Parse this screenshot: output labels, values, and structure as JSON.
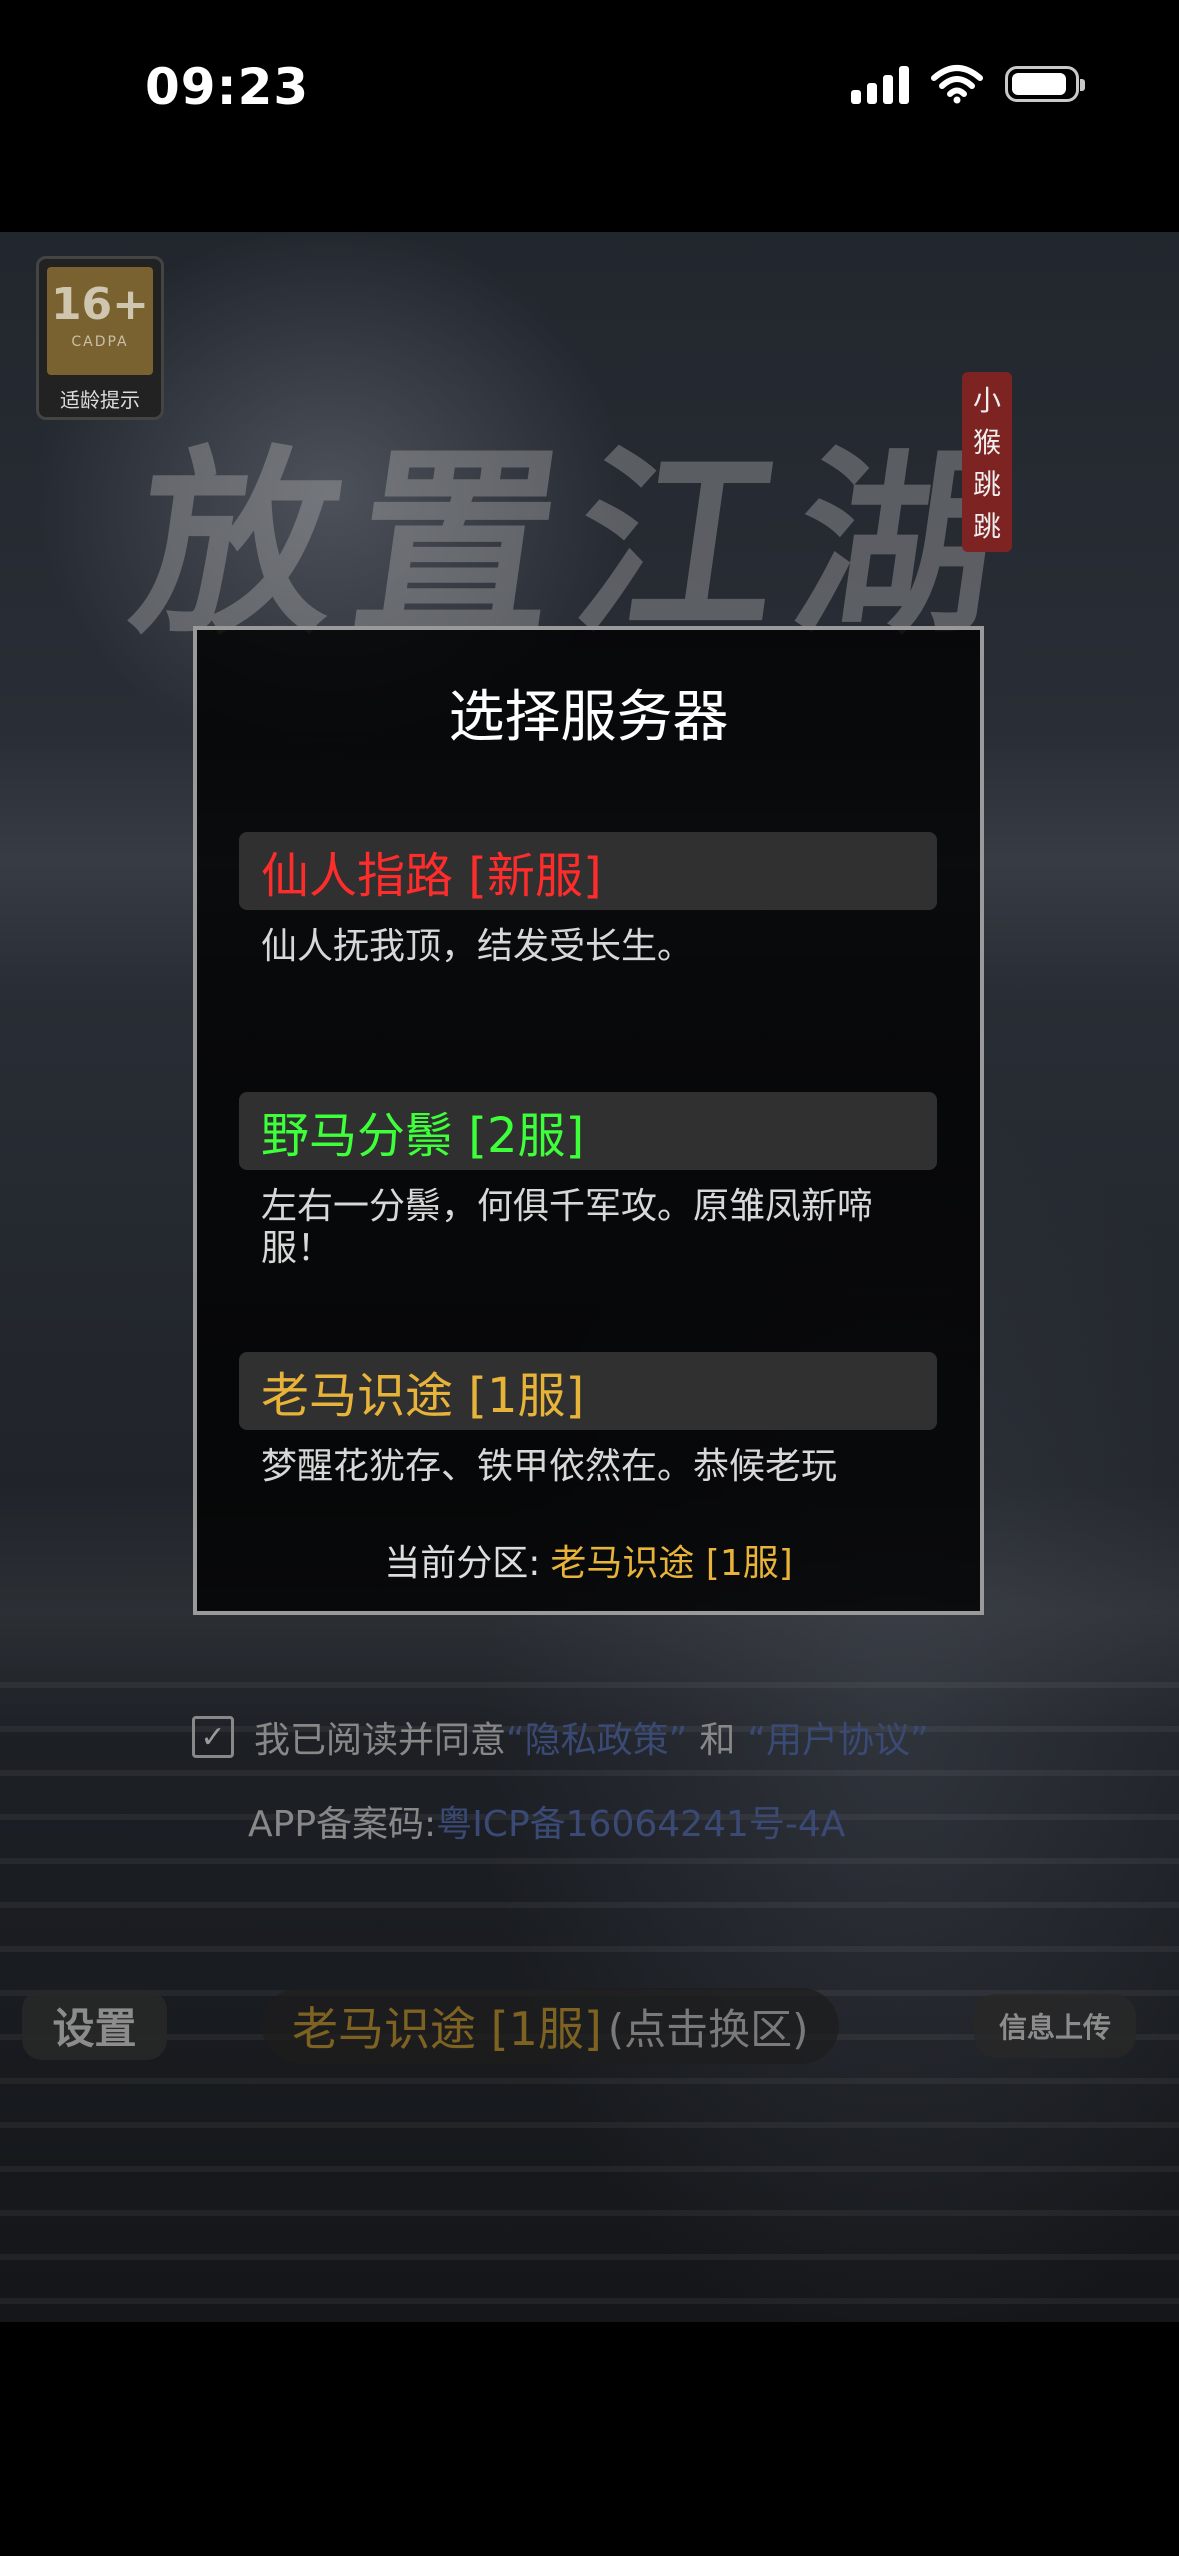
{
  "status_bar": {
    "time": "09:23"
  },
  "background": {
    "age_rating": {
      "number": "16+",
      "org": "CADPA",
      "tip": "适龄提示"
    },
    "logo_text": "放置江湖",
    "seal_text": "小猴跳跳"
  },
  "dialog": {
    "title": "选择服务器",
    "servers": [
      {
        "name": "仙人指路 [新服]",
        "description": "仙人抚我顶，结发受长生。",
        "color": "#ff2c2c"
      },
      {
        "name": "野马分鬃 [2服]",
        "description": "左右一分鬃，何俱千军攻。原雏凤新啼服！",
        "color": "#3dff3a"
      },
      {
        "name": "老马识途 [1服]",
        "description": "梦醒花犹存、铁甲依然在。恭候老玩",
        "color": "#e7b339"
      }
    ],
    "current_label": "当前分区:",
    "current_value": "老马识途 [1服]"
  },
  "agreement": {
    "checked": true,
    "prefix": "我已阅读并同意",
    "privacy_link": "“隐私政策”",
    "and": "和",
    "user_link": "“用户协议”"
  },
  "icp": {
    "label": "APP备案码:",
    "code": "粤ICP备16064241号-4A"
  },
  "bottom": {
    "settings": "设置",
    "server_name": "老马识途 [1服]",
    "switch_hint": "(点击换区)",
    "upload": "信息上传"
  }
}
